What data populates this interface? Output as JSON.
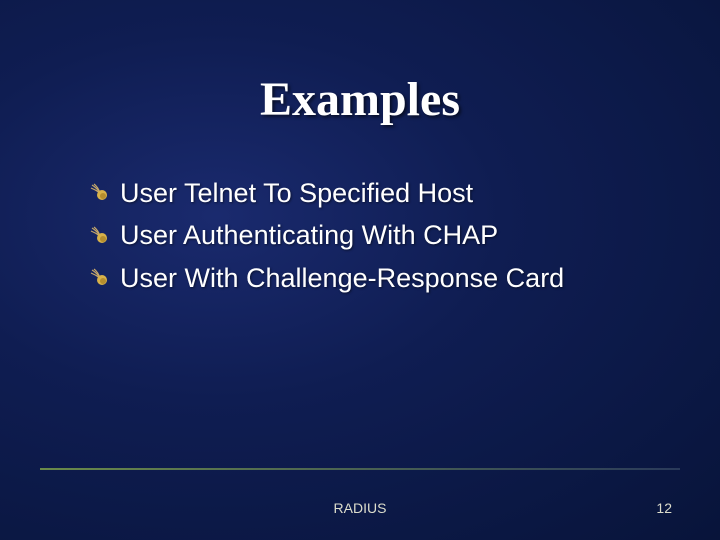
{
  "title": "Examples",
  "bullets": [
    {
      "text": "User Telnet To Specified Host"
    },
    {
      "text": "User Authenticating With CHAP"
    },
    {
      "text": "User With Challenge-Response Card"
    }
  ],
  "footer": {
    "label": "RADIUS",
    "page": "12"
  },
  "icons": {
    "comet": "comet-bullet"
  }
}
